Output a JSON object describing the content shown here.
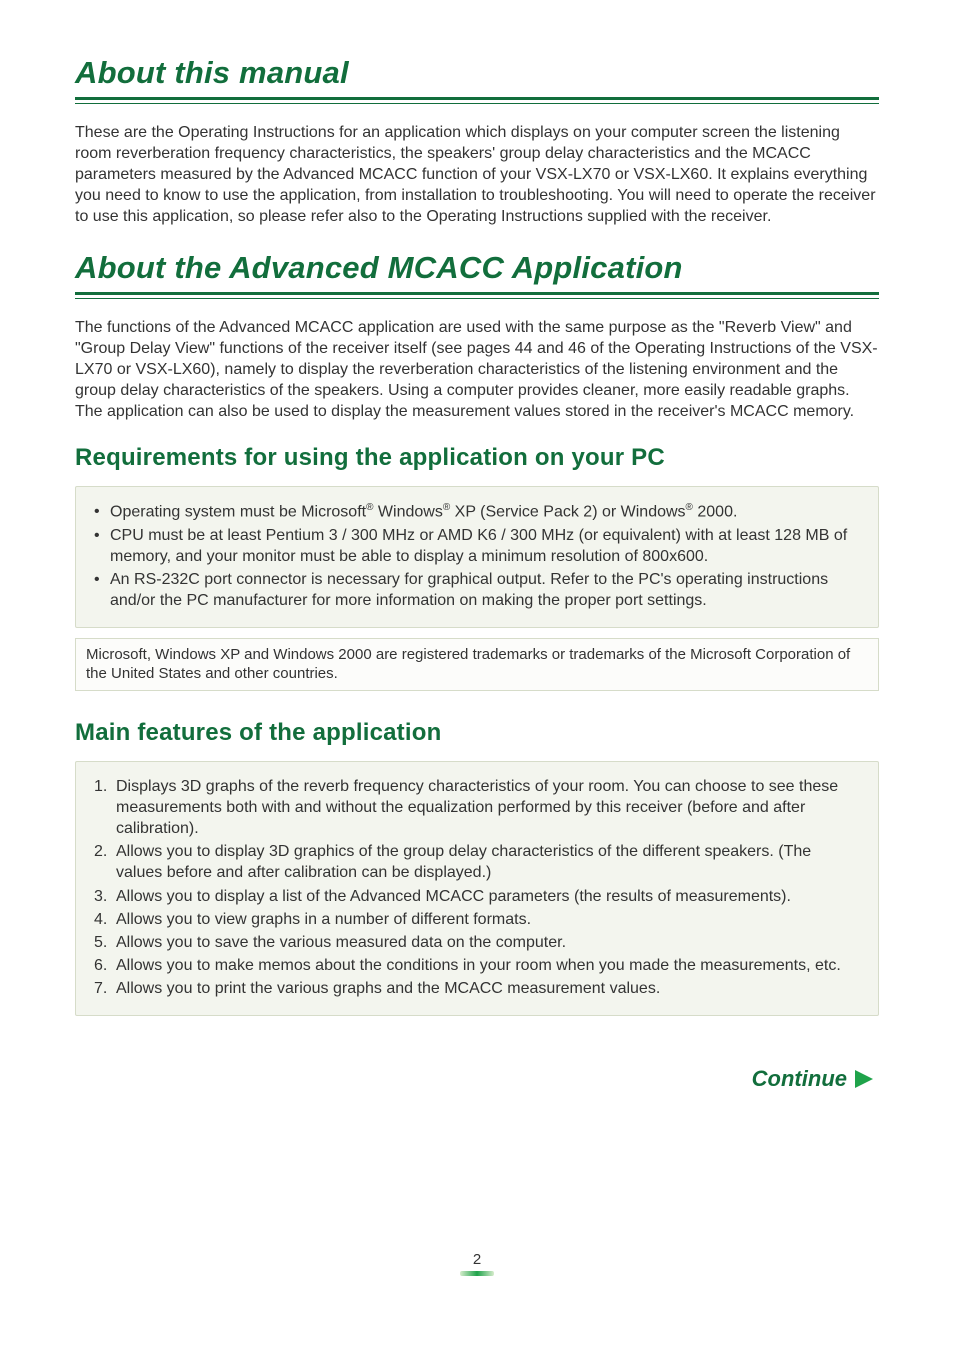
{
  "sections": {
    "about_manual": {
      "heading": "About this manual",
      "body": "These are the Operating Instructions for an application which displays on your computer screen the listening room reverberation frequency characteristics, the speakers' group delay characteristics and the MCACC parameters measured by the Advanced MCACC function of your VSX-LX70 or VSX-LX60. It explains everything you need to know to use the application, from installation to troubleshooting. You will need to operate the receiver to use this application, so please refer also to the Operating Instructions supplied with the receiver."
    },
    "about_app": {
      "heading": "About the Advanced MCACC Application",
      "body": "The functions of the Advanced MCACC application are used with the same purpose as the \"Reverb View\" and \"Group Delay View\" functions of the receiver itself (see pages 44 and 46 of the Operating Instructions of the VSX-LX70 or VSX-LX60), namely to display the reverberation characteristics of the listening environment and the group delay characteristics of the speakers. Using a computer provides cleaner, more easily readable graphs. The application can also be used to display the measurement values stored in the receiver's MCACC memory."
    },
    "requirements": {
      "heading": "Requirements for using the application on your PC",
      "items": {
        "r1_a": "Operating system must be Microsoft",
        "r1_b": " Windows",
        "r1_c": " XP (Service Pack 2) or Windows",
        "r1_d": " 2000.",
        "r2": "CPU must be at least Pentium 3 / 300 MHz or AMD K6 / 300 MHz (or equivalent) with at least 128 MB of memory, and your monitor must be able to display a minimum resolution of 800x600.",
        "r3": "An RS-232C port connector is necessary for graphical output. Refer to the PC's operating instructions and/or the PC manufacturer for more information on making the proper port settings."
      },
      "reg_symbol": "®",
      "trademark_note": "Microsoft, Windows XP and Windows 2000 are registered trademarks or trademarks of the Microsoft Corporation of the United States and other countries."
    },
    "features": {
      "heading": "Main features of the application",
      "items": {
        "f1": "Displays 3D graphs of the reverb frequency characteristics of your room. You can choose to see these measurements both with and without the equalization performed by this receiver (before and after calibration).",
        "f2": "Allows you to display 3D graphics of the group delay characteristics of the different speakers. (The values before and after calibration can be displayed.)",
        "f3": "Allows you to display a list of the Advanced MCACC parameters (the results of measurements).",
        "f4": "Allows you to view graphs in a number of different formats.",
        "f5": "Allows you to save the various measured data on the computer.",
        "f6": "Allows you to make memos about the conditions in your room when you made the measurements, etc.",
        "f7": "Allows you to print the various graphs and the MCACC measurement values."
      }
    }
  },
  "continue_label": "Continue",
  "page_number": "2"
}
